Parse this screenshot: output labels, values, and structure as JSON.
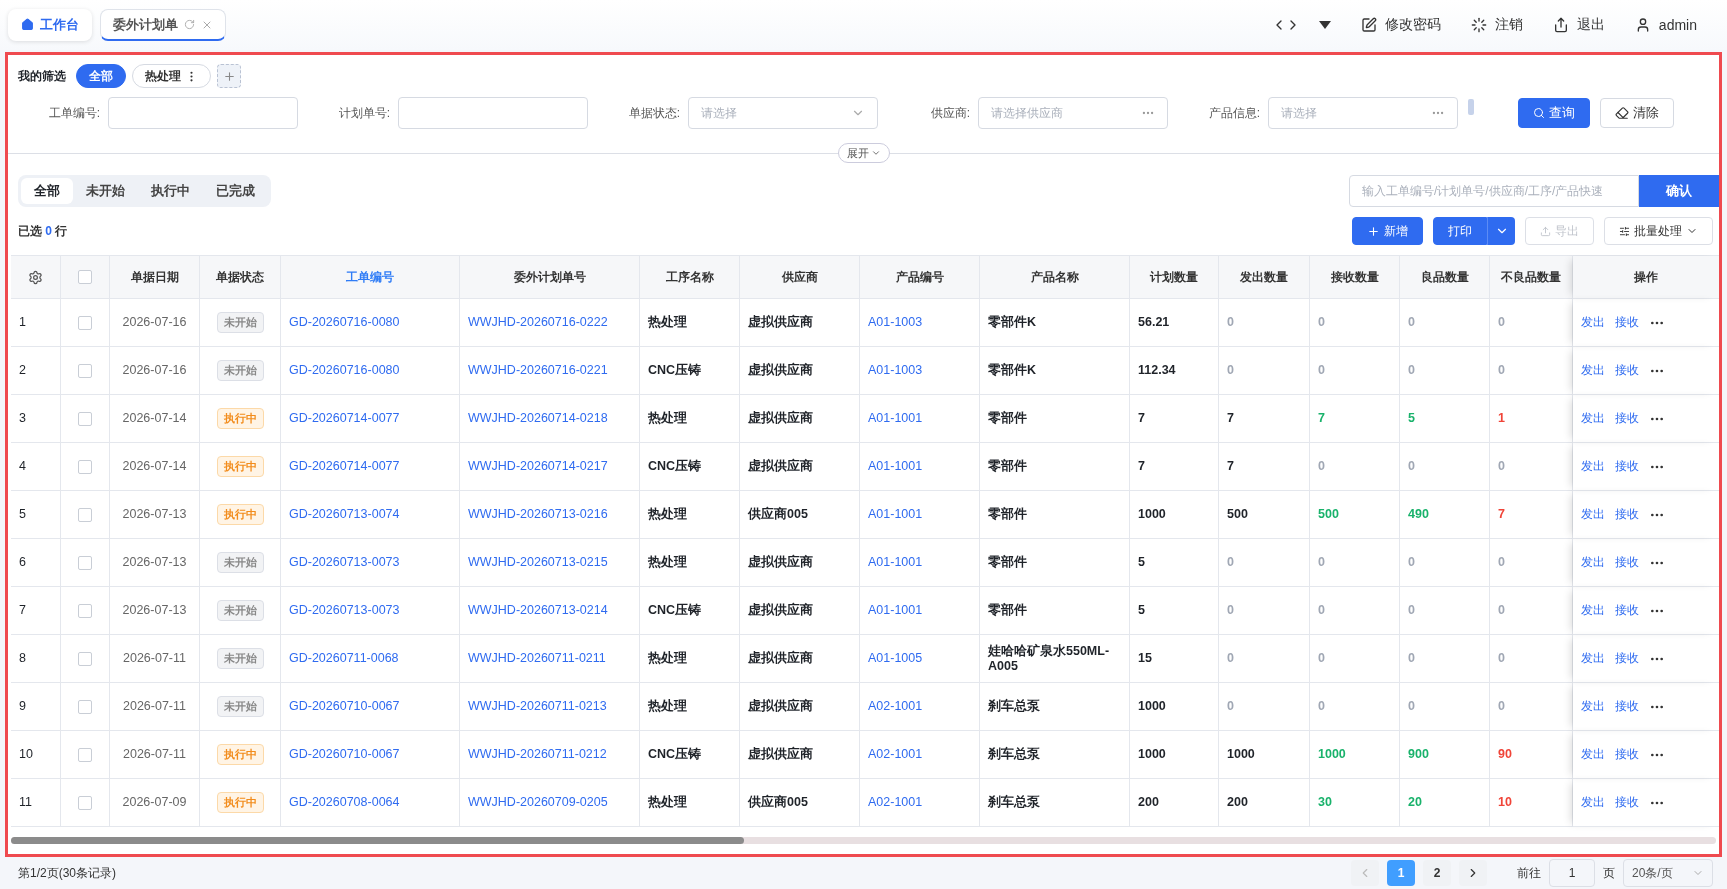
{
  "top_tabs": [
    {
      "label": "工作台",
      "kind": "home",
      "selected": false
    },
    {
      "label": "委外计划单",
      "kind": "page",
      "selected": true
    }
  ],
  "header_actions": [
    {
      "label": "修改密码",
      "kind": "edit"
    },
    {
      "label": "注销",
      "kind": "loader"
    },
    {
      "label": "退出",
      "kind": "exit"
    },
    {
      "label": "admin",
      "kind": "user"
    }
  ],
  "filter_presets": {
    "label": "我的筛选",
    "items": [
      {
        "label": "全部",
        "selected": true
      },
      {
        "label": "热处理",
        "selected": false
      }
    ]
  },
  "filters": [
    {
      "label": "工单编号:",
      "kind": "text"
    },
    {
      "label": "计划单号:",
      "kind": "text"
    },
    {
      "label": "单据状态:",
      "kind": "select",
      "placeholder": "请选择"
    },
    {
      "label": "供应商:",
      "kind": "picker",
      "placeholder": "请选择供应商"
    },
    {
      "label": "产品信息:",
      "kind": "picker",
      "placeholder": "请选择"
    }
  ],
  "filter_buttons": [
    {
      "label": "查询",
      "kind": "primary"
    },
    {
      "label": "清除",
      "kind": "default"
    }
  ],
  "expand_label": "展开",
  "status_tabs": [
    {
      "label": "全部",
      "selected": true
    },
    {
      "label": "未开始",
      "selected": false
    },
    {
      "label": "执行中",
      "selected": false
    },
    {
      "label": "已完成",
      "selected": false
    }
  ],
  "quick_search": {
    "placeholder": "输入工单编号/计划单号/供应商/工序/产品快速",
    "button": "确认"
  },
  "selection": {
    "prefix": "已选",
    "count": "0",
    "suffix": "行"
  },
  "toolbar": [
    {
      "label": "新增",
      "kind": "add",
      "disabled": false
    },
    {
      "label": "打印",
      "kind": "split",
      "disabled": false
    },
    {
      "label": "导出",
      "kind": "export",
      "disabled": true
    },
    {
      "label": "批量处理",
      "kind": "batch",
      "disabled": false
    }
  ],
  "table": {
    "header_checked": false,
    "columns": [
      {
        "label": "单据日期",
        "highlighted": false
      },
      {
        "label": "单据状态",
        "highlighted": false
      },
      {
        "label": "工单编号",
        "highlighted": true
      },
      {
        "label": "委外计划单号",
        "highlighted": false
      },
      {
        "label": "工序名称",
        "highlighted": false
      },
      {
        "label": "供应商",
        "highlighted": false
      },
      {
        "label": "产品编号",
        "highlighted": false
      },
      {
        "label": "产品名称",
        "highlighted": false
      },
      {
        "label": "计划数量",
        "highlighted": false
      },
      {
        "label": "发出数量",
        "highlighted": false
      },
      {
        "label": "接收数量",
        "highlighted": false
      },
      {
        "label": "良品数量",
        "highlighted": false
      },
      {
        "label": "不良品数量",
        "highlighted": false
      },
      {
        "label": "操作",
        "highlighted": false
      }
    ],
    "rows": [
      {
        "index": "1",
        "checked": false,
        "date": "2026-07-16",
        "status": {
          "label": "未开始",
          "kind": "pending"
        },
        "work_order": "GD-20260716-0080",
        "plan_no": "WWJHD-20260716-0222",
        "process": "热处理",
        "supplier": "虚拟供应商",
        "product_code": "A01-1003",
        "product_name": "零部件K",
        "quantities": [
          {
            "text": "56.21",
            "kind": "plain"
          },
          {
            "text": "0",
            "kind": "zero"
          },
          {
            "text": "0",
            "kind": "zero"
          },
          {
            "text": "0",
            "kind": "zero"
          },
          {
            "text": "0",
            "kind": "zero"
          }
        ],
        "actions": [
          "发出",
          "接收"
        ]
      },
      {
        "index": "2",
        "checked": false,
        "date": "2026-07-16",
        "status": {
          "label": "未开始",
          "kind": "pending"
        },
        "work_order": "GD-20260716-0080",
        "plan_no": "WWJHD-20260716-0221",
        "process": "CNC压铸",
        "supplier": "虚拟供应商",
        "product_code": "A01-1003",
        "product_name": "零部件K",
        "quantities": [
          {
            "text": "112.34",
            "kind": "plain"
          },
          {
            "text": "0",
            "kind": "zero"
          },
          {
            "text": "0",
            "kind": "zero"
          },
          {
            "text": "0",
            "kind": "zero"
          },
          {
            "text": "0",
            "kind": "zero"
          }
        ],
        "actions": [
          "发出",
          "接收"
        ]
      },
      {
        "index": "3",
        "checked": false,
        "date": "2026-07-14",
        "status": {
          "label": "执行中",
          "kind": "running"
        },
        "work_order": "GD-20260714-0077",
        "plan_no": "WWJHD-20260714-0218",
        "process": "热处理",
        "supplier": "虚拟供应商",
        "product_code": "A01-1001",
        "product_name": "零部件",
        "quantities": [
          {
            "text": "7",
            "kind": "plain"
          },
          {
            "text": "7",
            "kind": "plain"
          },
          {
            "text": "7",
            "kind": "good"
          },
          {
            "text": "5",
            "kind": "good"
          },
          {
            "text": "1",
            "kind": "bad"
          }
        ],
        "actions": [
          "发出",
          "接收"
        ]
      },
      {
        "index": "4",
        "checked": false,
        "date": "2026-07-14",
        "status": {
          "label": "执行中",
          "kind": "running"
        },
        "work_order": "GD-20260714-0077",
        "plan_no": "WWJHD-20260714-0217",
        "process": "CNC压铸",
        "supplier": "虚拟供应商",
        "product_code": "A01-1001",
        "product_name": "零部件",
        "quantities": [
          {
            "text": "7",
            "kind": "plain"
          },
          {
            "text": "7",
            "kind": "plain"
          },
          {
            "text": "0",
            "kind": "zero"
          },
          {
            "text": "0",
            "kind": "zero"
          },
          {
            "text": "0",
            "kind": "zero"
          }
        ],
        "actions": [
          "发出",
          "接收"
        ]
      },
      {
        "index": "5",
        "checked": false,
        "date": "2026-07-13",
        "status": {
          "label": "执行中",
          "kind": "running"
        },
        "work_order": "GD-20260713-0074",
        "plan_no": "WWJHD-20260713-0216",
        "process": "热处理",
        "supplier": "供应商005",
        "product_code": "A01-1001",
        "product_name": "零部件",
        "quantities": [
          {
            "text": "1000",
            "kind": "plain"
          },
          {
            "text": "500",
            "kind": "plain"
          },
          {
            "text": "500",
            "kind": "good"
          },
          {
            "text": "490",
            "kind": "good"
          },
          {
            "text": "7",
            "kind": "bad"
          }
        ],
        "actions": [
          "发出",
          "接收"
        ]
      },
      {
        "index": "6",
        "checked": false,
        "date": "2026-07-13",
        "status": {
          "label": "未开始",
          "kind": "pending"
        },
        "work_order": "GD-20260713-0073",
        "plan_no": "WWJHD-20260713-0215",
        "process": "热处理",
        "supplier": "虚拟供应商",
        "product_code": "A01-1001",
        "product_name": "零部件",
        "quantities": [
          {
            "text": "5",
            "kind": "plain"
          },
          {
            "text": "0",
            "kind": "zero"
          },
          {
            "text": "0",
            "kind": "zero"
          },
          {
            "text": "0",
            "kind": "zero"
          },
          {
            "text": "0",
            "kind": "zero"
          }
        ],
        "actions": [
          "发出",
          "接收"
        ]
      },
      {
        "index": "7",
        "checked": false,
        "date": "2026-07-13",
        "status": {
          "label": "未开始",
          "kind": "pending"
        },
        "work_order": "GD-20260713-0073",
        "plan_no": "WWJHD-20260713-0214",
        "process": "CNC压铸",
        "supplier": "虚拟供应商",
        "product_code": "A01-1001",
        "product_name": "零部件",
        "quantities": [
          {
            "text": "5",
            "kind": "plain"
          },
          {
            "text": "0",
            "kind": "zero"
          },
          {
            "text": "0",
            "kind": "zero"
          },
          {
            "text": "0",
            "kind": "zero"
          },
          {
            "text": "0",
            "kind": "zero"
          }
        ],
        "actions": [
          "发出",
          "接收"
        ]
      },
      {
        "index": "8",
        "checked": false,
        "date": "2026-07-11",
        "status": {
          "label": "未开始",
          "kind": "pending"
        },
        "work_order": "GD-20260711-0068",
        "plan_no": "WWJHD-20260711-0211",
        "process": "热处理",
        "supplier": "虚拟供应商",
        "product_code": "A01-1005",
        "product_name": "娃哈哈矿泉水550ML-A005",
        "quantities": [
          {
            "text": "15",
            "kind": "plain"
          },
          {
            "text": "0",
            "kind": "zero"
          },
          {
            "text": "0",
            "kind": "zero"
          },
          {
            "text": "0",
            "kind": "zero"
          },
          {
            "text": "0",
            "kind": "zero"
          }
        ],
        "actions": [
          "发出",
          "接收"
        ]
      },
      {
        "index": "9",
        "checked": false,
        "date": "2026-07-11",
        "status": {
          "label": "未开始",
          "kind": "pending"
        },
        "work_order": "GD-20260710-0067",
        "plan_no": "WWJHD-20260711-0213",
        "process": "热处理",
        "supplier": "虚拟供应商",
        "product_code": "A02-1001",
        "product_name": "刹车总泵",
        "quantities": [
          {
            "text": "1000",
            "kind": "plain"
          },
          {
            "text": "0",
            "kind": "zero"
          },
          {
            "text": "0",
            "kind": "zero"
          },
          {
            "text": "0",
            "kind": "zero"
          },
          {
            "text": "0",
            "kind": "zero"
          }
        ],
        "actions": [
          "发出",
          "接收"
        ]
      },
      {
        "index": "10",
        "checked": false,
        "date": "2026-07-11",
        "status": {
          "label": "执行中",
          "kind": "running"
        },
        "work_order": "GD-20260710-0067",
        "plan_no": "WWJHD-20260711-0212",
        "process": "CNC压铸",
        "supplier": "虚拟供应商",
        "product_code": "A02-1001",
        "product_name": "刹车总泵",
        "quantities": [
          {
            "text": "1000",
            "kind": "plain"
          },
          {
            "text": "1000",
            "kind": "plain"
          },
          {
            "text": "1000",
            "kind": "good"
          },
          {
            "text": "900",
            "kind": "good"
          },
          {
            "text": "90",
            "kind": "bad"
          }
        ],
        "actions": [
          "发出",
          "接收"
        ]
      },
      {
        "index": "11",
        "checked": false,
        "date": "2026-07-09",
        "status": {
          "label": "执行中",
          "kind": "running"
        },
        "work_order": "GD-20260708-0064",
        "plan_no": "WWJHD-20260709-0205",
        "process": "热处理",
        "supplier": "供应商005",
        "product_code": "A02-1001",
        "product_name": "刹车总泵",
        "quantities": [
          {
            "text": "200",
            "kind": "plain"
          },
          {
            "text": "200",
            "kind": "plain"
          },
          {
            "text": "30",
            "kind": "good"
          },
          {
            "text": "20",
            "kind": "good"
          },
          {
            "text": "10",
            "kind": "bad"
          }
        ],
        "actions": [
          "发出",
          "接收"
        ]
      }
    ]
  },
  "pagination": {
    "summary": "第1/2页(30条记录)",
    "pages": [
      {
        "label": "1",
        "selected": true
      },
      {
        "label": "2",
        "selected": false
      }
    ],
    "goto_label": "前往",
    "goto_value": "1",
    "page_unit": "页",
    "page_size": "20条/页"
  }
}
